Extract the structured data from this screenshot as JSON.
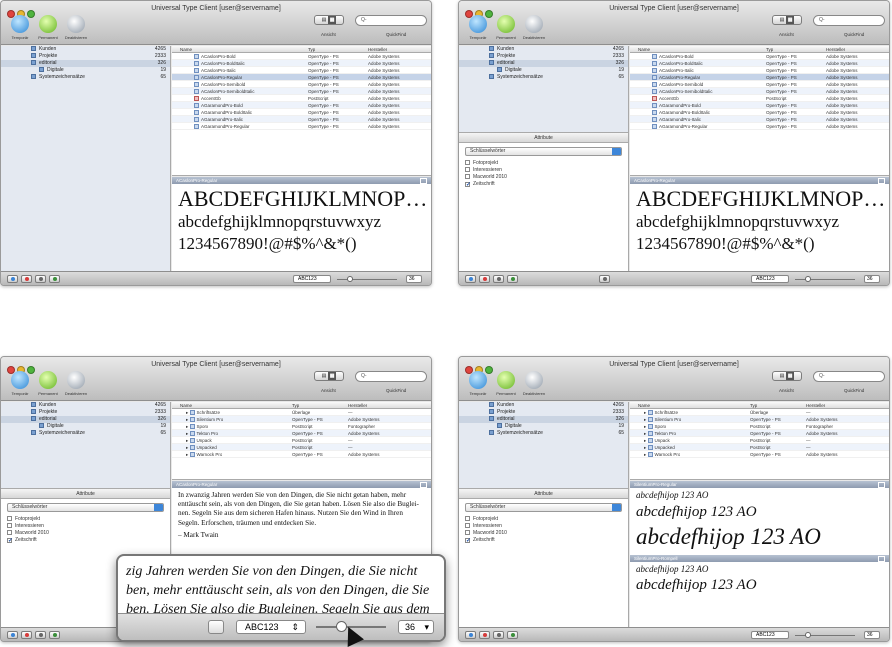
{
  "window": {
    "title": "Universal Type Client [user@servername]",
    "toolbar": {
      "temporary": "Temporär",
      "permanent": "Permanent",
      "deactivate": "Deaktivieren"
    },
    "view_label": "Ansicht",
    "quickfind_label": "QuickFind",
    "search_placeholder": "Q-"
  },
  "sidebar": {
    "items": [
      {
        "label": "Kunden",
        "count": "4265"
      },
      {
        "label": "Projekte",
        "count": "2333"
      },
      {
        "label": "editorial",
        "count": "326"
      },
      {
        "label": "Digitale",
        "count": "19"
      },
      {
        "label": "Systemzeichensätze",
        "count": "65"
      }
    ],
    "attributes_title": "Attribute",
    "keyword_select": "Schlüsselwörter",
    "checkboxes": [
      {
        "label": "Fotoprojekt",
        "checked": false
      },
      {
        "label": "Interessieren",
        "checked": false
      },
      {
        "label": "Macworld 2010",
        "checked": false
      },
      {
        "label": "Zeitschrift",
        "checked": true
      }
    ]
  },
  "table": {
    "columns": {
      "name": "Name",
      "type": "Typ",
      "manufacturer": "Hersteller"
    },
    "rows": [
      {
        "name": "ACaslonPro-Bold",
        "type": "OpenType - PS",
        "maker": "Adobe Systems"
      },
      {
        "name": "ACaslonPro-BoldItalic",
        "type": "OpenType - PS",
        "maker": "Adobe Systems"
      },
      {
        "name": "ACaslonPro-Italic",
        "type": "OpenType - PS",
        "maker": "Adobe Systems"
      },
      {
        "name": "ACaslonPro-Regular",
        "type": "OpenType - PS",
        "maker": "Adobe Systems"
      },
      {
        "name": "ACaslonPro-Semibold",
        "type": "OpenType - PS",
        "maker": "Adobe Systems"
      },
      {
        "name": "ACaslonPro-SemiboldItalic",
        "type": "OpenType - PS",
        "maker": "Adobe Systems"
      },
      {
        "name": "AccentGb",
        "type": "PostScript",
        "maker": "Adobe Systems"
      },
      {
        "name": "AGaramondPro-Bold",
        "type": "OpenType - PS",
        "maker": "Adobe Systems"
      },
      {
        "name": "AGaramondPro-BoldItalic",
        "type": "OpenType - PS",
        "maker": "Adobe Systems"
      },
      {
        "name": "AGaramondPro-Italic",
        "type": "OpenType - PS",
        "maker": "Adobe Systems"
      },
      {
        "name": "AGaramondPro-Regular",
        "type": "OpenType - PS",
        "maker": "Adobe Systems"
      }
    ],
    "sets_rows": [
      {
        "name": "Schriftsätze",
        "type": "Überlage",
        "maker": "—"
      },
      {
        "name": "Silentium Pro",
        "type": "OpenType - PS",
        "maker": "Adobe Systems"
      },
      {
        "name": "Sporx",
        "type": "PostScript",
        "maker": "Fontographer"
      },
      {
        "name": "Tekton Pro",
        "type": "OpenType - PS",
        "maker": "Adobe Systems"
      },
      {
        "name": "Unpack",
        "type": "PostScript",
        "maker": "—"
      },
      {
        "name": "Unpacked",
        "type": "PostScript",
        "maker": "—"
      },
      {
        "name": "Warnock Pro",
        "type": "OpenType - PS",
        "maker": "Adobe Systems"
      }
    ]
  },
  "preview": {
    "font_name": "ACaslonPro-Regular",
    "upper": "ABCDEFGHIJKLMNOP…",
    "lower": "abcdefghijklmnopqrstuvwxyz",
    "digits": "1234567890!@#$%^&*()",
    "paragraph": "In zwanzig Jahren werden Sie von den Dingen, die Sie nicht getan haben, mehr enttäuscht sein, als von den Dingen, die Sie getan haben. Lösen Sie also die Buglei­nen. Segeln Sie aus dem sicheren Hafen hinaus. Nutzen Sie den Wind in Ihren Segeln. Erforschen, träumen und entdecken Sie.",
    "author": "– Mark Twain",
    "zoom_lines": [
      "zig Jahren werden Sie von den Dingen, die Sie nicht",
      "ben, mehr enttäuscht sein, als von den Dingen, die Sie",
      "ben. Lösen Sie also die Bugleinen. Segeln Sie aus dem"
    ],
    "waterfall_font_1": "SilentiumPro-Regular",
    "waterfall_font_2": "SilentiumPro-Rompell",
    "sample": "abcdefhijop 123 AO",
    "sample_mode": "ABC123",
    "size": "36"
  }
}
